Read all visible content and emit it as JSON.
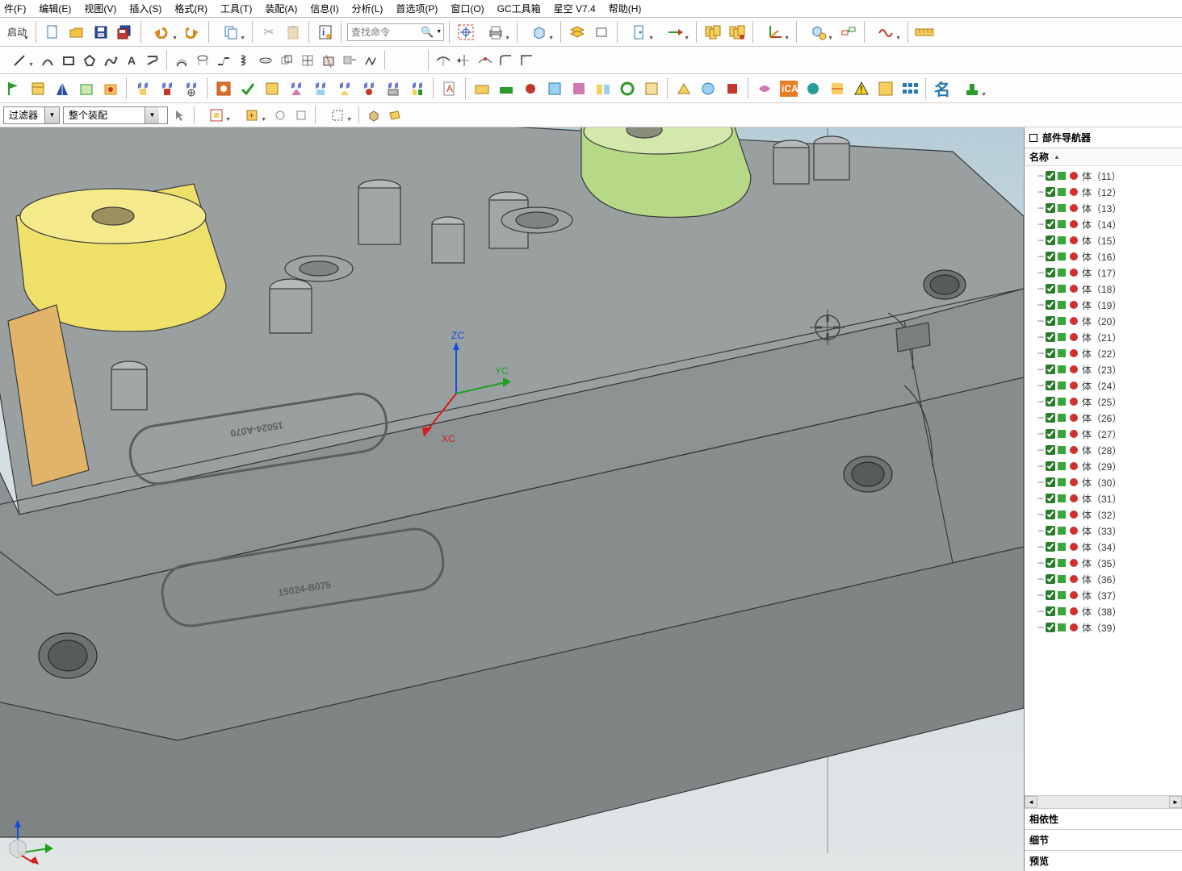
{
  "menu": {
    "items": [
      "件(F)",
      "编辑(E)",
      "视图(V)",
      "插入(S)",
      "格式(R)",
      "工具(T)",
      "装配(A)",
      "信息(I)",
      "分析(L)",
      "首选项(P)",
      "窗口(O)",
      "GC工具箱",
      "星空 V7.4",
      "帮助(H)"
    ]
  },
  "toolbars": {
    "start_label": "启动",
    "search_placeholder": "查找命令"
  },
  "filters": {
    "filter_label": "过滤器",
    "assembly_value": "整个装配"
  },
  "navigator": {
    "title": "部件导航器",
    "header": "名称",
    "node_prefix": "体",
    "start_index": 11,
    "end_index": 39,
    "dep_section": "相依性",
    "detail_section": "细节",
    "preview_section": "预览"
  },
  "model": {
    "axis_x": "XC",
    "axis_y": "YC",
    "axis_z": "ZC",
    "label_top": "15024-A070",
    "label_bottom": "15024-B075"
  }
}
